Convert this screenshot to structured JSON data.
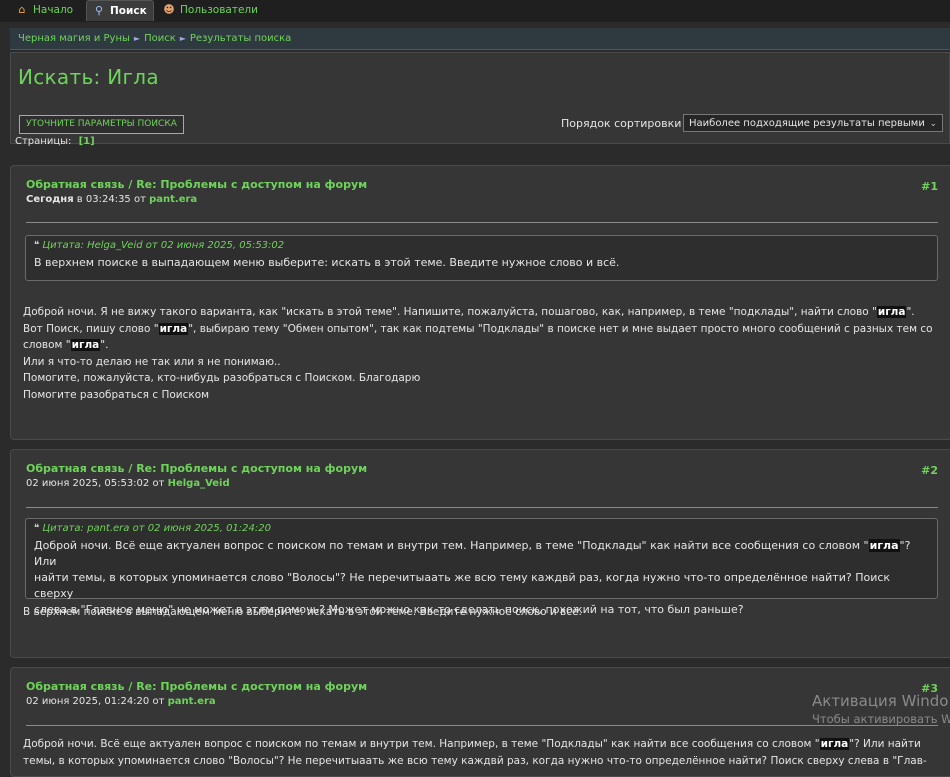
{
  "nav": {
    "home_label": "Начало",
    "search_label": "Поиск",
    "users_label": "Пользователи"
  },
  "breadcrumb": {
    "items": [
      "Черная магия и Руны",
      "Поиск",
      "Результаты поиска"
    ],
    "separator": "►"
  },
  "header": {
    "title": "Искать: Игла",
    "refine_button": "УТОЧНИТЕ ПАРАМЕТРЫ ПОИСКА",
    "sort_label": "Порядок сортировки",
    "sort_value": "Наиболее подходящие результаты первыми"
  },
  "pages": {
    "label": "Страницы:",
    "current": "[1]"
  },
  "posts": [
    {
      "title": "Обратная связь / Re: Проблемы с доступом на форум",
      "number": "#1",
      "date_bold": "Сегодня",
      "date_rest": " в 03:24:35 от ",
      "author": "pant.era",
      "quote_head": "Цитата: Helga_Veid от 02 июня 2025, 05:53:02",
      "quote_body": "В верхнем поиске в выпадающем меню выберите: искать в этой теме. Введите нужное слово и всё.",
      "body": [
        [
          "Доброй ночи. Я не вижу такого варианта, как \"искать в этой теме\". Напишите, пожалуйста, пошагово, как, например, в теме \"подклады\", найти слово \"",
          "игла",
          "\"."
        ],
        [
          "Вот Поиск, пишу слово \"",
          "игла",
          "\", выбираю тему \"Обмен опытом\", так как подтемы \"Подклады\" в поиске нет и мне выдает просто много сообщений с разных тем со"
        ],
        [
          "словом \"",
          "игла",
          "\"."
        ],
        [
          "Или я что-то делаю не так или я не понимаю.."
        ],
        [
          "Помогите, пожалуйста, кто-нибудь разобраться с Поиском. Благодарю"
        ],
        [
          "Помогите разобраться с Поиском"
        ]
      ]
    },
    {
      "title": "Обратная связь / Re: Проблемы с доступом на форум",
      "number": "#2",
      "date_bold": "",
      "date_rest": "02 июня 2025, 05:53:02 от ",
      "author": "Helga_Veid",
      "quote_head": "Цитата: pant.era от 02 июня 2025, 01:24:20",
      "quote_lines": [
        [
          "Доброй ночи. Всё еще актуален вопрос с поиском по темам и внутри тем. Например, в теме \"Подклады\" как найти все сообщения со словом \"",
          "игла",
          "\"? Или"
        ],
        [
          "найти темы, в которых упоминается слово \"Волосы\"? Не перечитыаать же всю тему каждвй раз, когда нужно что-то определённое найти? Поиск сверху"
        ],
        [
          "слева в \"Главное меню\" не может в этлм помочь? Может можно как-то сделать поиск, похожий на тот, что был раньше?"
        ]
      ],
      "body": [
        [
          "В верхнем поиске в выпадающем меню выберите: искать в этой теме. Введите нужное слово и всё."
        ]
      ]
    },
    {
      "title": "Обратная связь / Re: Проблемы с доступом на форум",
      "number": "#3",
      "date_bold": "",
      "date_rest": "02 июня 2025, 01:24:20 от ",
      "author": "pant.era",
      "body": [
        [
          "Доброй ночи. Всё еще актуален вопрос с поиском по темам и внутри тем. Например, в теме \"Подклады\" как найти все сообщения со словом \"",
          "игла",
          "\"? Или найти"
        ],
        [
          "темы, в которых упоминается слово \"Волосы\"? Не перечитыаать же всю тему каждвй раз, когда нужно что-то определённое найти? Поиск сверху слева в \"Глав-"
        ]
      ]
    }
  ],
  "watermark": {
    "line1": "Активация Windo",
    "line2": "Чтобы активировать Win"
  }
}
